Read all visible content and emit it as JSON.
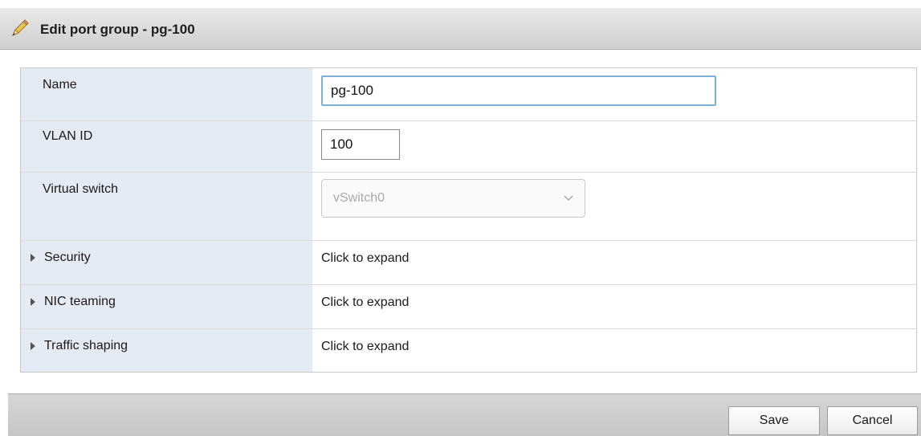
{
  "dialog": {
    "title": "Edit port group - pg-100",
    "title_icon": "pencil-icon"
  },
  "form": {
    "name": {
      "label": "Name",
      "value": "pg-100"
    },
    "vlan": {
      "label": "VLAN ID",
      "value": "100"
    },
    "vswitch": {
      "label": "Virtual switch",
      "selected": "vSwitch0",
      "disabled": true
    },
    "sections": [
      {
        "label": "Security",
        "value": "Click to expand"
      },
      {
        "label": "NIC teaming",
        "value": "Click to expand"
      },
      {
        "label": "Traffic shaping",
        "value": "Click to expand"
      }
    ]
  },
  "footer": {
    "save_label": "Save",
    "cancel_label": "Cancel"
  },
  "colors": {
    "label_column": "#e5ebf5",
    "focused_border": "#7fb1d8",
    "titlebar": "#dcdcdc"
  }
}
